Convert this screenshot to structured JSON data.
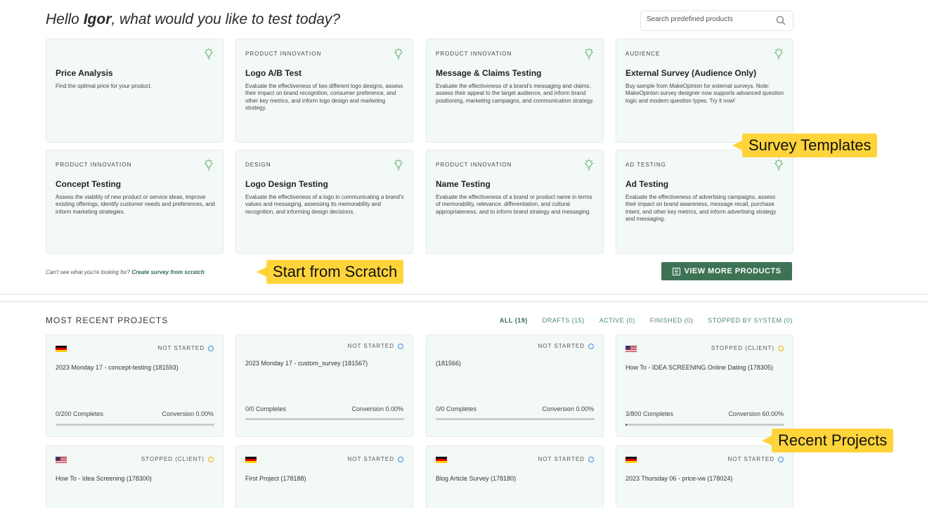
{
  "header": {
    "greeting_pre": "Hello ",
    "user_name": "Igor",
    "greeting_post": ", what would you like to test today?"
  },
  "search": {
    "placeholder": "Search predefined products"
  },
  "templates": [
    {
      "category": "",
      "title": "Price Analysis",
      "description": "Find the optimal price for your product."
    },
    {
      "category": "PRODUCT INNOVATION",
      "title": "Logo A/B Test",
      "description": "Evaluate the effectiveness of two different logo designs, assess their impact on brand recognition, consumer preference, and other key metrics, and inform logo design and marketing strategy."
    },
    {
      "category": "PRODUCT INNOVATION",
      "title": "Message & Claims Testing",
      "description": "Evaluate the effectiveness of a brand's messaging and claims, assess their appeal to the target audience, and inform brand positioning, marketing campaigns, and communication strategy."
    },
    {
      "category": "AUDIENCE",
      "title": "External Survey (Audience Only)",
      "description": "Buy sample from MakeOpinion for external surveys. Note: MakeOpinion survey designer now supports advanced question logic and modern question types. Try it now!"
    },
    {
      "category": "PRODUCT INNOVATION",
      "title": "Concept Testing",
      "description": "Assess the viability of new product or service ideas, improve existing offerings, identify customer needs and preferences, and inform marketing strategies."
    },
    {
      "category": "DESIGN",
      "title": "Logo Design Testing",
      "description": "Evaluate the effectiveness of a logo in communicating a brand's values and messaging, assessing its memorability and recognition, and informing design decisions."
    },
    {
      "category": "PRODUCT INNOVATION",
      "title": "Name Testing",
      "description": "Evaluate the effectiveness of a brand or product name in terms of memorability, relevance, differentiation, and cultural appropriateness, and to inform brand strategy and messaging."
    },
    {
      "category": "AD TESTING",
      "title": "Ad Testing",
      "description": "Evaluate the effectiveness of advertising campaigns, assess their impact on brand awareness, message recall, purchase intent, and other key metrics, and inform advertising strategy and messaging."
    }
  ],
  "scratch": {
    "prefix": "Can't see what you're looking for? ",
    "link": "Create survey from scratch"
  },
  "view_more": {
    "label": "VIEW MORE PRODUCTS"
  },
  "recent": {
    "title": "MOST RECENT PROJECTS",
    "filters": [
      "ALL (19)",
      "DRAFTS (15)",
      "ACTIVE (0)",
      "FINISHED (0)",
      "STOPPED BY SYSTEM (0)"
    ],
    "projects": [
      {
        "flag": "de",
        "status": "NOT STARTED",
        "status_color": "#3a8ee6",
        "name": "2023 Monday 17 - concept-testing (181593)",
        "completes": "0/200 Completes",
        "conversion": "Conversion 0.00%",
        "progress": 0
      },
      {
        "flag": "",
        "status": "NOT STARTED",
        "status_color": "#3a8ee6",
        "name": "2023 Monday 17 - custom_survey (181567)",
        "completes": "0/0 Completes",
        "conversion": "Conversion 0.00%",
        "progress": 0
      },
      {
        "flag": "",
        "status": "NOT STARTED",
        "status_color": "#3a8ee6",
        "name": "(181566)",
        "completes": "0/0 Completes",
        "conversion": "Conversion 0.00%",
        "progress": 0
      },
      {
        "flag": "us",
        "status": "STOPPED (CLIENT)",
        "status_color": "#f0b400",
        "name": "How To - IDEA SCREENING Online Dating (178305)",
        "completes": "3/800 Completes",
        "conversion": "Conversion 60.00%",
        "progress": 0.004
      },
      {
        "flag": "us",
        "status": "STOPPED (CLIENT)",
        "status_color": "#f0b400",
        "name": "How To - Idea Screening (178300)"
      },
      {
        "flag": "de",
        "status": "NOT STARTED",
        "status_color": "#3a8ee6",
        "name": "First Project (178188)"
      },
      {
        "flag": "de",
        "status": "NOT STARTED",
        "status_color": "#3a8ee6",
        "name": "Blog Article Survey (178180)"
      },
      {
        "flag": "de",
        "status": "NOT STARTED",
        "status_color": "#3a8ee6",
        "name": "2023 Thursday 06 - price-vw (178024)"
      }
    ]
  },
  "callouts": {
    "survey_templates": "Survey Templates",
    "start_scratch": "Start from Scratch",
    "recent_projects": "Recent Projects"
  },
  "colors": {
    "accent": "#3d7354",
    "card_bg": "#f3f9f6",
    "callout": "#ffd43a"
  }
}
